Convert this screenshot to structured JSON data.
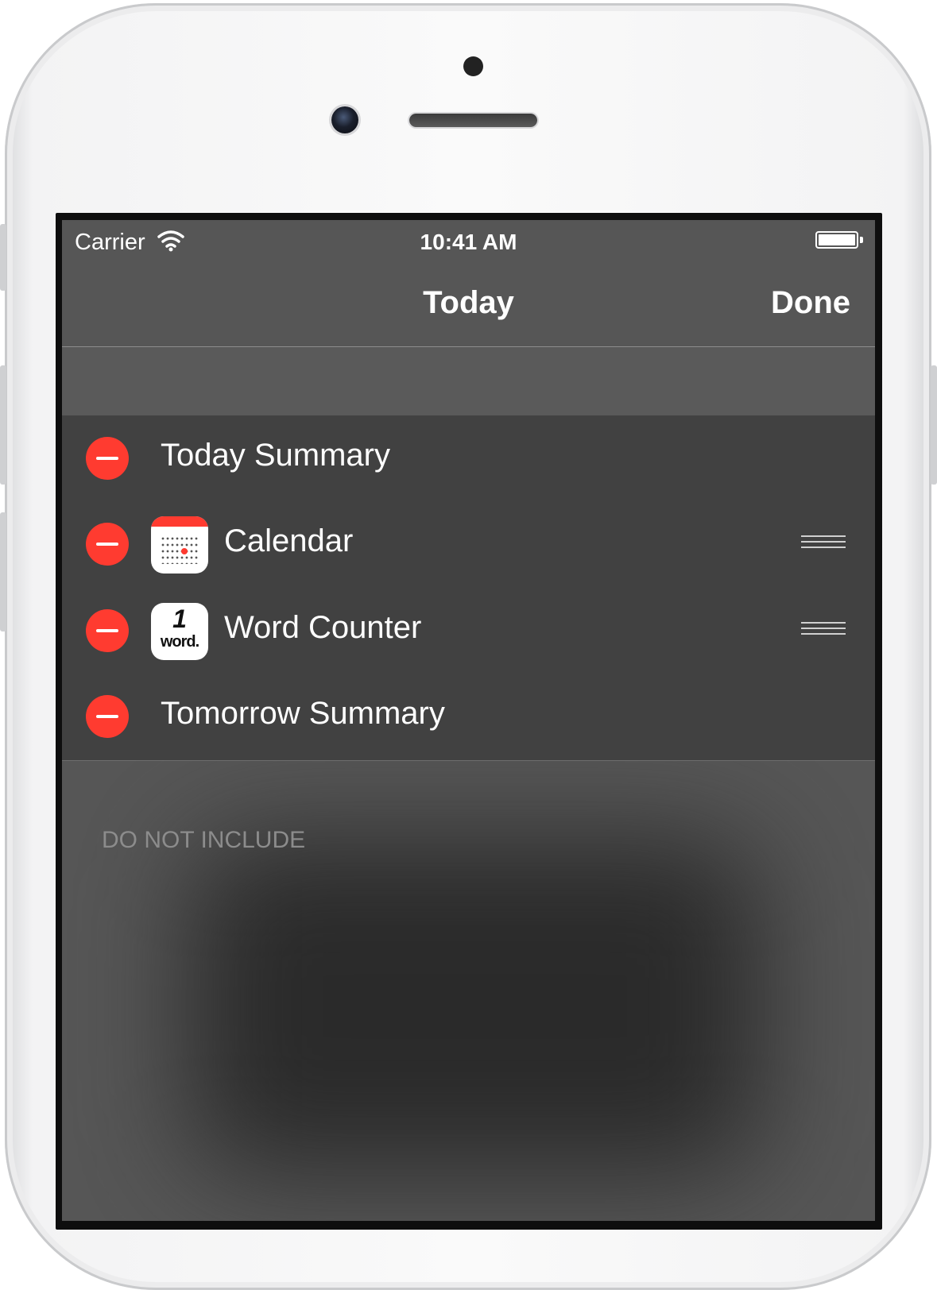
{
  "status_bar": {
    "carrier": "Carrier",
    "time": "10:41 AM",
    "wifi_icon": "wifi-icon",
    "battery_icon": "battery-icon",
    "battery_level": 1.0
  },
  "nav_bar": {
    "title": "Today",
    "done_label": "Done"
  },
  "widgets": [
    {
      "label": "Today Summary",
      "icon": null
    },
    {
      "label": "Calendar",
      "icon": "calendar-app-icon"
    },
    {
      "label": "Word Counter",
      "icon": "word-counter-app-icon",
      "icon_text": [
        "1",
        "word."
      ]
    },
    {
      "label": "Tomorrow Summary",
      "icon": null
    }
  ],
  "do_not_include": {
    "header": "DO NOT INCLUDE"
  },
  "colors": {
    "delete": "#ff3b30",
    "list_bg": "#414141",
    "screen_bg": "#565656"
  }
}
